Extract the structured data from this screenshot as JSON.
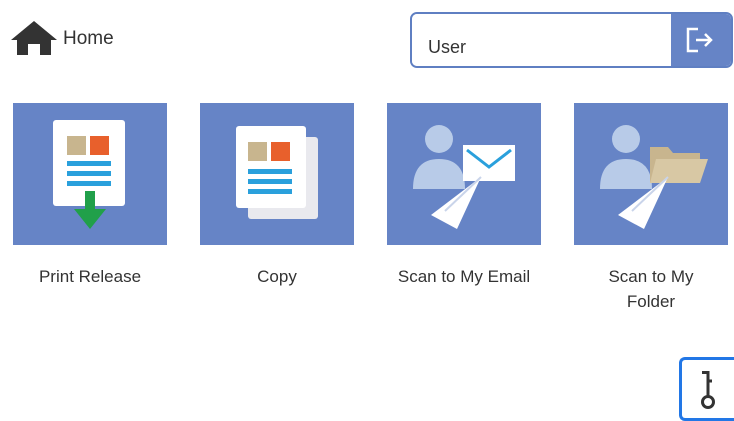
{
  "header": {
    "home_label": "Home",
    "user_value": "User"
  },
  "icons": {
    "home": "home-icon",
    "logout": "logout-icon",
    "key": "key-icon"
  },
  "tiles": [
    {
      "id": "print-release",
      "label": "Print Release",
      "icon": "print-release-icon"
    },
    {
      "id": "copy",
      "label": "Copy",
      "icon": "copy-icon"
    },
    {
      "id": "scan-to-my-email",
      "label": "Scan to My Email",
      "icon": "scan-email-icon"
    },
    {
      "id": "scan-to-my-folder",
      "label": "Scan to My Folder",
      "icon": "scan-folder-icon"
    }
  ],
  "colors": {
    "tile_bg": "#6684c6",
    "accent_blue": "#2277e6",
    "doc_tan": "#c8b58e",
    "doc_orange": "#e8602c",
    "doc_line_blue": "#2aa0dc",
    "arrow_green": "#21a04a",
    "person_blue": "#b8cbe8"
  }
}
